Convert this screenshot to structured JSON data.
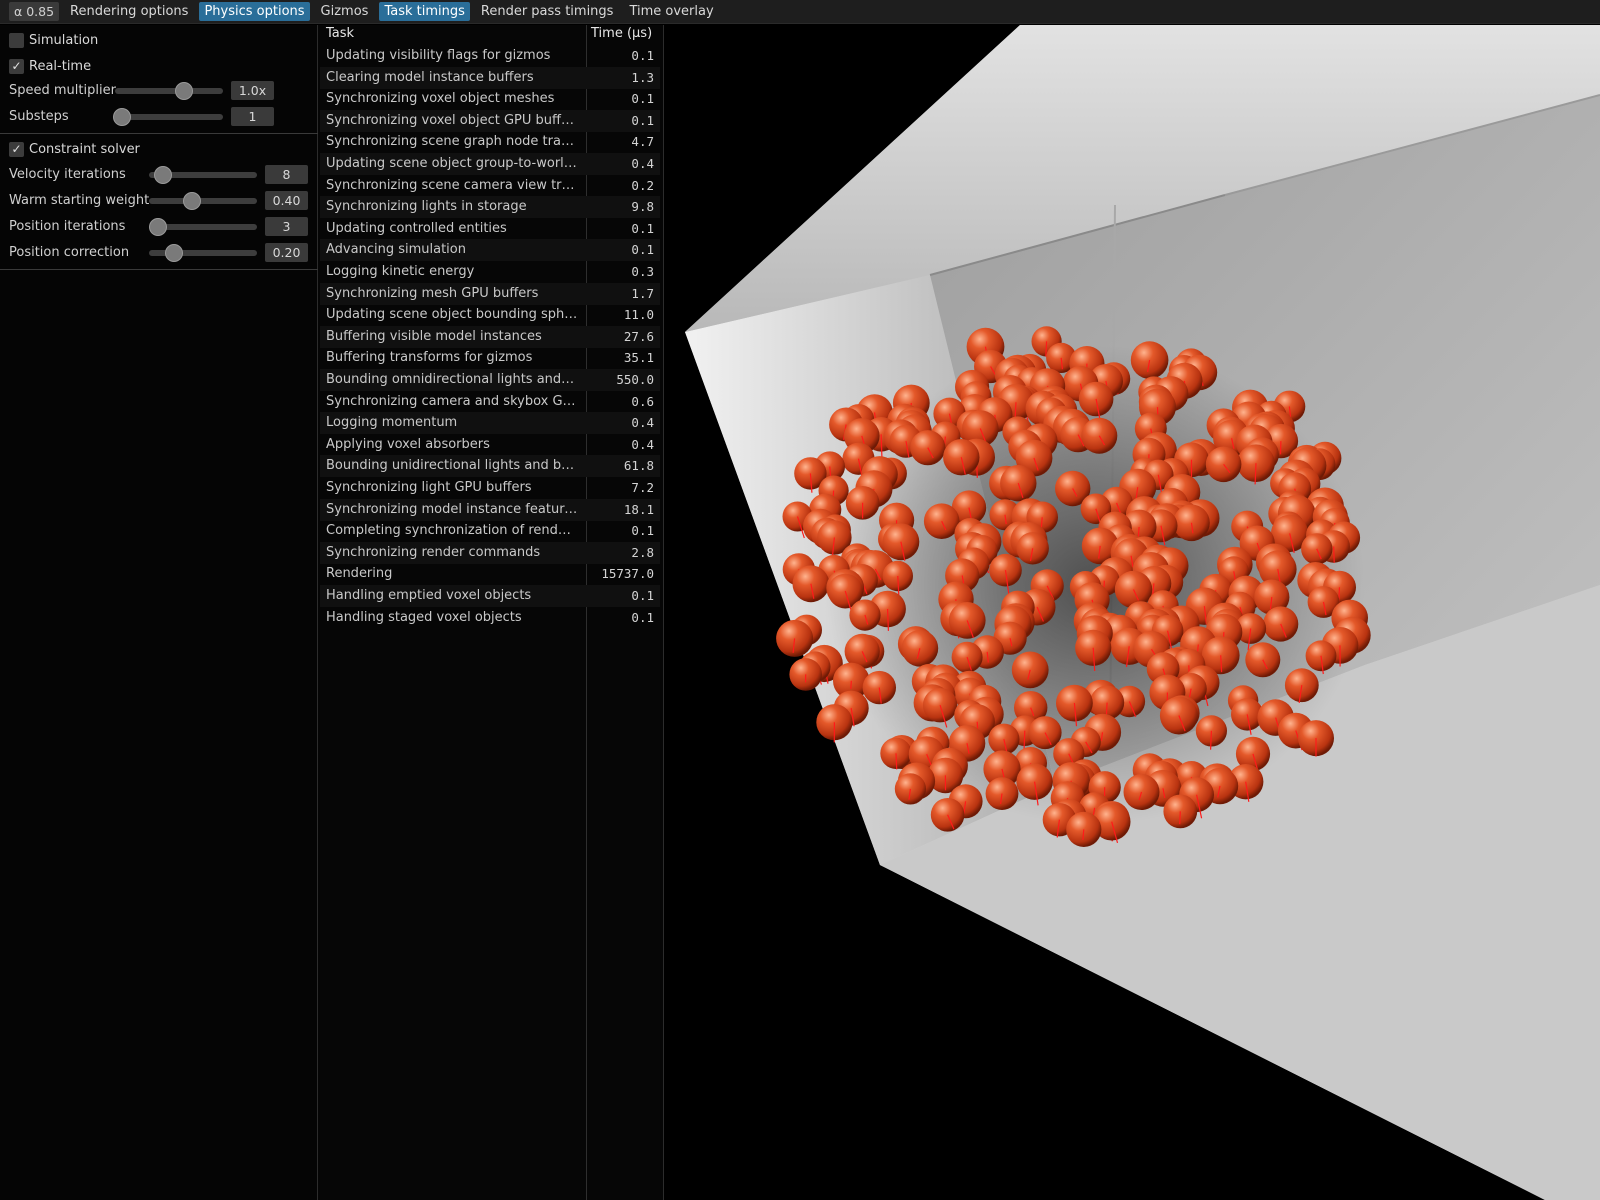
{
  "menubar": {
    "alpha_badge": "α 0.85",
    "items": [
      {
        "label": "Rendering options",
        "active": false
      },
      {
        "label": "Physics options",
        "active": true
      },
      {
        "label": "Gizmos",
        "active": false
      },
      {
        "label": "Task timings",
        "active": true
      },
      {
        "label": "Render pass timings",
        "active": false
      },
      {
        "label": "Time overlay",
        "active": false
      }
    ]
  },
  "physics": {
    "simulation": {
      "label": "Simulation",
      "checked": false
    },
    "realtime": {
      "label": "Real-time",
      "checked": true
    },
    "speed_multiplier": {
      "label": "Speed multiplier",
      "value": "1.0x"
    },
    "substeps": {
      "label": "Substeps",
      "value": "1"
    },
    "constraint_solver": {
      "label": "Constraint solver",
      "checked": true
    },
    "velocity_iterations": {
      "label": "Velocity iterations",
      "value": "8"
    },
    "warm_starting_weight": {
      "label": "Warm starting weight",
      "value": "0.40"
    },
    "position_iterations": {
      "label": "Position iterations",
      "value": "3"
    },
    "position_correction": {
      "label": "Position correction",
      "value": "0.20"
    }
  },
  "tasks": {
    "header_task": "Task",
    "header_time": "Time (μs)",
    "rows": [
      {
        "name": "Updating visibility flags for gizmos",
        "time": "0.1"
      },
      {
        "name": "Clearing model instance buffers",
        "time": "1.3"
      },
      {
        "name": "Synchronizing voxel object meshes",
        "time": "0.1"
      },
      {
        "name": "Synchronizing voxel object GPU buffers",
        "time": "0.1"
      },
      {
        "name": "Synchronizing scene graph node transfo…",
        "time": "4.7"
      },
      {
        "name": "Updating scene object group-to-world tr…",
        "time": "0.4"
      },
      {
        "name": "Synchronizing scene camera view transf…",
        "time": "0.2"
      },
      {
        "name": "Synchronizing lights in storage",
        "time": "9.8"
      },
      {
        "name": "Updating controlled entities",
        "time": "0.1"
      },
      {
        "name": "Advancing simulation",
        "time": "0.1"
      },
      {
        "name": "Logging kinetic energy",
        "time": "0.3"
      },
      {
        "name": "Synchronizing mesh GPU buffers",
        "time": "1.7"
      },
      {
        "name": "Updating scene object bounding spheres",
        "time": "11.0"
      },
      {
        "name": "Buffering visible model instances",
        "time": "27.6"
      },
      {
        "name": "Buffering transforms for gizmos",
        "time": "35.1"
      },
      {
        "name": "Bounding omnidirectional lights and bu…",
        "time": "550.0"
      },
      {
        "name": "Synchronizing camera and skybox GPU r…",
        "time": "0.6"
      },
      {
        "name": "Logging momentum",
        "time": "0.4"
      },
      {
        "name": "Applying voxel absorbers",
        "time": "0.4"
      },
      {
        "name": "Bounding unidirectional lights and buff…",
        "time": "61.8"
      },
      {
        "name": "Synchronizing light GPU buffers",
        "time": "7.2"
      },
      {
        "name": "Synchronizing model instance feature G…",
        "time": "18.1"
      },
      {
        "name": "Completing synchronization of render r…",
        "time": "0.1"
      },
      {
        "name": "Synchronizing render commands",
        "time": "2.8"
      },
      {
        "name": "Rendering",
        "time": "15737.0"
      },
      {
        "name": "Handling emptied voxel objects",
        "time": "0.1"
      },
      {
        "name": "Handling staged voxel objects",
        "time": "0.1"
      }
    ]
  },
  "colors": {
    "accent": "#2a6e99",
    "sphere": "#d9461c",
    "velocity_gizmo": "#ff1a1a",
    "box_surface": "#cfcfcf"
  }
}
